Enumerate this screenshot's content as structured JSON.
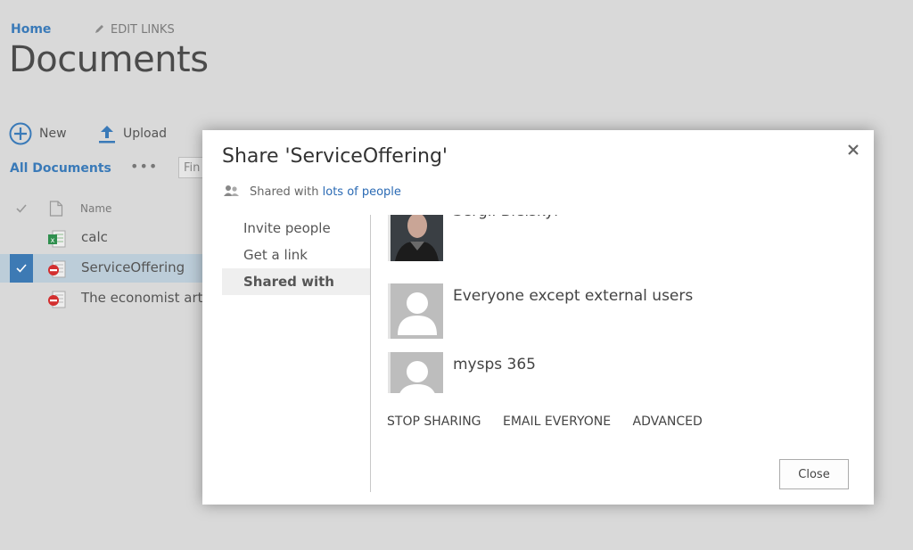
{
  "nav": {
    "home": "Home",
    "edit_links": "EDIT LINKS",
    "page_title": "Documents"
  },
  "commands": {
    "new_label": "New",
    "upload_label": "Upload"
  },
  "views": {
    "current": "All Documents",
    "more": "•••",
    "find_placeholder": "Fin"
  },
  "list": {
    "header_name": "Name",
    "rows": [
      {
        "name": "calc",
        "type": "excel",
        "selected": false
      },
      {
        "name": "ServiceOffering",
        "type": "blocked",
        "selected": true
      },
      {
        "name": "The economist artic",
        "type": "blocked",
        "selected": false
      }
    ]
  },
  "dialog": {
    "title": "Share 'ServiceOffering'",
    "shared_prefix": "Shared with ",
    "shared_link": "lots of people",
    "nav": [
      {
        "label": "Invite people",
        "active": false
      },
      {
        "label": "Get a link",
        "active": false
      },
      {
        "label": "Shared with",
        "active": true
      }
    ],
    "people": [
      {
        "name": "Sergii Bielskyi",
        "avatar": "photo"
      },
      {
        "name": "Everyone except external users",
        "avatar": "placeholder"
      },
      {
        "name": "mysps 365",
        "avatar": "placeholder"
      }
    ],
    "actions": [
      "STOP SHARING",
      "EMAIL EVERYONE",
      "ADVANCED"
    ],
    "close_label": "Close"
  },
  "colors": {
    "accent": "#3a7ab8",
    "link": "#2a6ab4",
    "selected_row": "#bccdd9",
    "overlay_bg": "#d9d9d9"
  }
}
